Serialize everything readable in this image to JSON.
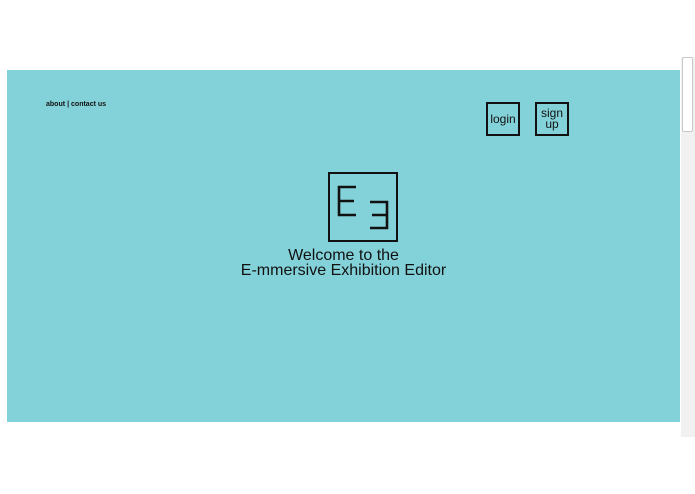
{
  "nav": {
    "about": "about",
    "separator": "|",
    "contact": "contact us"
  },
  "auth": {
    "login_label": "login",
    "signup_label": "sign up"
  },
  "logo": {
    "icon": "e-mirrored-e-logo-icon"
  },
  "hero": {
    "welcome_line1": "Welcome to the",
    "welcome_line2": "E-mmersive Exhibition Editor"
  },
  "colors": {
    "hero_background": "#84d2d9",
    "foreground": "#111111",
    "page_background": "#ffffff"
  }
}
